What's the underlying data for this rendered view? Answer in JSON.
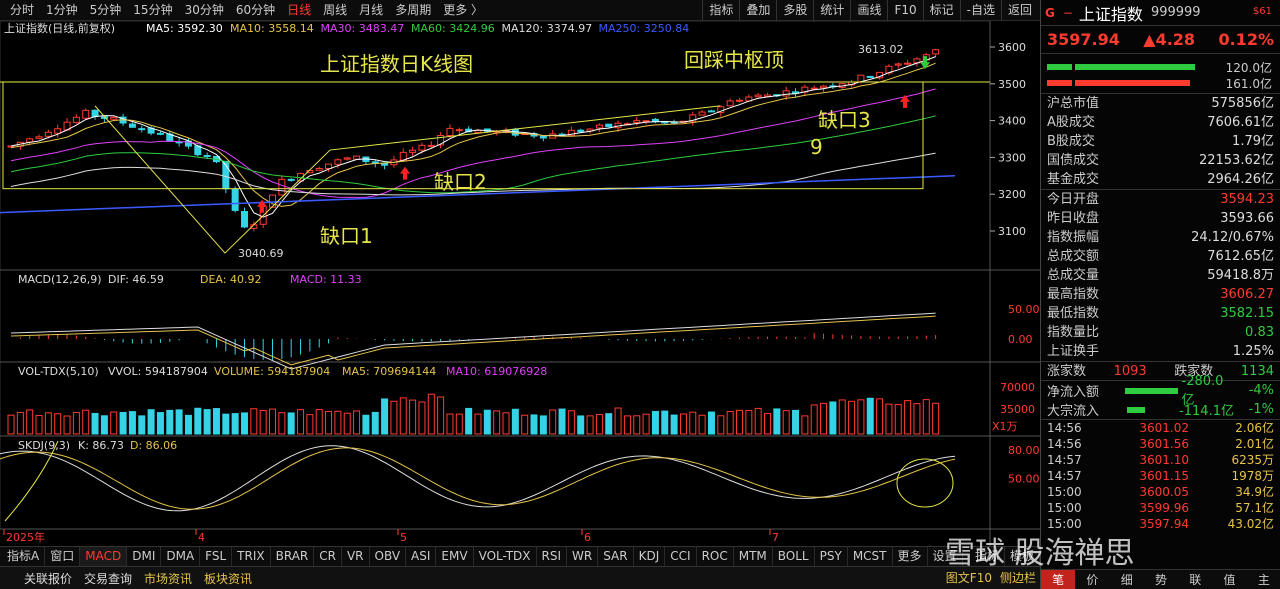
{
  "toolbar": {
    "timeframes": [
      "分时",
      "1分钟",
      "5分钟",
      "15分钟",
      "30分钟",
      "60分钟",
      "日线",
      "周线",
      "月线",
      "多周期",
      "更多 〉"
    ],
    "active_timeframe": "日线",
    "tools": [
      "指标",
      "叠加",
      "多股",
      "统计",
      "画线",
      "F10",
      "标记",
      "-自选",
      "返回"
    ]
  },
  "main_chart": {
    "title": "上证指数(日线,前复权)",
    "ma_legend": [
      {
        "label": "MA5: 3592.30",
        "color": "#ffffff"
      },
      {
        "label": "MA10: 3558.14",
        "color": "#e6c34a"
      },
      {
        "label": "MA30: 3483.47",
        "color": "#e040fb"
      },
      {
        "label": "MA60: 3424.96",
        "color": "#2ecc40"
      },
      {
        "label": "MA120: 3374.97",
        "color": "#dddddd"
      },
      {
        "label": "MA250: 3250.84",
        "color": "#3b5bff"
      }
    ],
    "annotations": {
      "title_note": "上证指数日K线图",
      "pullback_note": "回踩中枢顶",
      "gap1": "缺口1",
      "gap2": "缺口2",
      "gap3": "缺口3",
      "nine": "9",
      "high_label": "3613.02",
      "low_label": "3040.69"
    },
    "y_ticks": [
      "3600",
      "3500",
      "3400",
      "3300",
      "3200",
      "3100"
    ]
  },
  "macd": {
    "legend": "MACD(12,26,9)",
    "dif": "DIF: 46.59",
    "dea": "DEA: 40.92",
    "macd": "MACD: 11.33",
    "y_ticks": [
      "50.00",
      "0.00"
    ]
  },
  "vol": {
    "legend": "VOL-TDX(5,10)",
    "vvol": "VVOL: 594187904",
    "volume": "VOLUME: 594187904",
    "ma5": "MA5: 709694144",
    "ma10": "MA10: 619076928",
    "y_ticks": [
      "70000",
      "35000"
    ],
    "unit": "X1万"
  },
  "skdj": {
    "legend": "SKDJ(9,3)",
    "k": "K: 86.73",
    "d": "D: 86.06",
    "y_ticks": [
      "80.00",
      "50.00"
    ]
  },
  "x_axis": {
    "labels": [
      "2025年",
      "4",
      "5",
      "6",
      "7"
    ]
  },
  "indicator_tabs": [
    "指标A",
    "窗口",
    "MACD",
    "DMI",
    "DMA",
    "FSL",
    "TRIX",
    "BRAR",
    "CR",
    "VR",
    "OBV",
    "ASI",
    "EMV",
    "VOL-TDX",
    "RSI",
    "WR",
    "SAR",
    "KDJ",
    "CCI",
    "ROC",
    "MTM",
    "BOLL",
    "PSY",
    "MCST",
    "更多",
    "设置"
  ],
  "active_indicator": "MACD",
  "indicator_right": [
    "指标",
    "模板"
  ],
  "status_bar": {
    "items": [
      "关联报价",
      "交易查询",
      "市场资讯",
      "板块资讯"
    ],
    "right": [
      "图文F10",
      "侧边栏"
    ]
  },
  "panel": {
    "symbol": "上证指数",
    "code": "999999",
    "badge": "$61",
    "price": "3597.94",
    "change": "▲4.28",
    "pct": "0.12%",
    "bar_labels": [
      "120.0亿",
      "161.0亿"
    ],
    "stats1": [
      {
        "label": "沪总市值",
        "value": "575856亿",
        "cls": ""
      },
      {
        "label": "A股成交",
        "value": "7606.61亿",
        "cls": ""
      },
      {
        "label": "B股成交",
        "value": "1.79亿",
        "cls": ""
      },
      {
        "label": "国债成交",
        "value": "22153.62亿",
        "cls": ""
      },
      {
        "label": "基金成交",
        "value": "2964.26亿",
        "cls": ""
      }
    ],
    "stats2": [
      {
        "label": "今日开盘",
        "value": "3594.23",
        "cls": "red"
      },
      {
        "label": "昨日收盘",
        "value": "3593.66",
        "cls": ""
      },
      {
        "label": "指数振幅",
        "value": "24.12/0.67%",
        "cls": ""
      },
      {
        "label": "总成交额",
        "value": "7612.65亿",
        "cls": ""
      },
      {
        "label": "总成交量",
        "value": "59418.8万",
        "cls": ""
      },
      {
        "label": "最高指数",
        "value": "3606.27",
        "cls": "red"
      },
      {
        "label": "最低指数",
        "value": "3582.15",
        "cls": "grn"
      },
      {
        "label": "指数量比",
        "value": "0.83",
        "cls": "grn"
      },
      {
        "label": "上证换手",
        "value": "1.25%",
        "cls": ""
      }
    ],
    "updown": {
      "up_label": "涨家数",
      "up": "1093",
      "down_label": "跌家数",
      "down": "1134"
    },
    "flow": [
      {
        "label": "净流入额",
        "value": "-280.0亿",
        "pct": "-4%",
        "bar": 0.6
      },
      {
        "label": "大宗流入",
        "value": "-114.1亿",
        "pct": "-1%",
        "bar": 0.2
      }
    ],
    "ticks": [
      {
        "t": "14:56",
        "p": "3601.02",
        "v": "2.06亿"
      },
      {
        "t": "14:56",
        "p": "3601.56",
        "v": "2.01亿"
      },
      {
        "t": "14:57",
        "p": "3601.10",
        "v": "6235万"
      },
      {
        "t": "14:57",
        "p": "3601.15",
        "v": "1978万"
      },
      {
        "t": "15:00",
        "p": "3600.05",
        "v": "34.9亿"
      },
      {
        "t": "15:00",
        "p": "3599.96",
        "v": "57.1亿"
      },
      {
        "t": "15:00",
        "p": "3597.94",
        "v": "43.02亿"
      }
    ],
    "tabs": [
      "笔",
      "价",
      "细",
      "势",
      "联",
      "值",
      "主"
    ],
    "active_tab": "笔"
  },
  "watermark": "雪球 股海禅思"
}
